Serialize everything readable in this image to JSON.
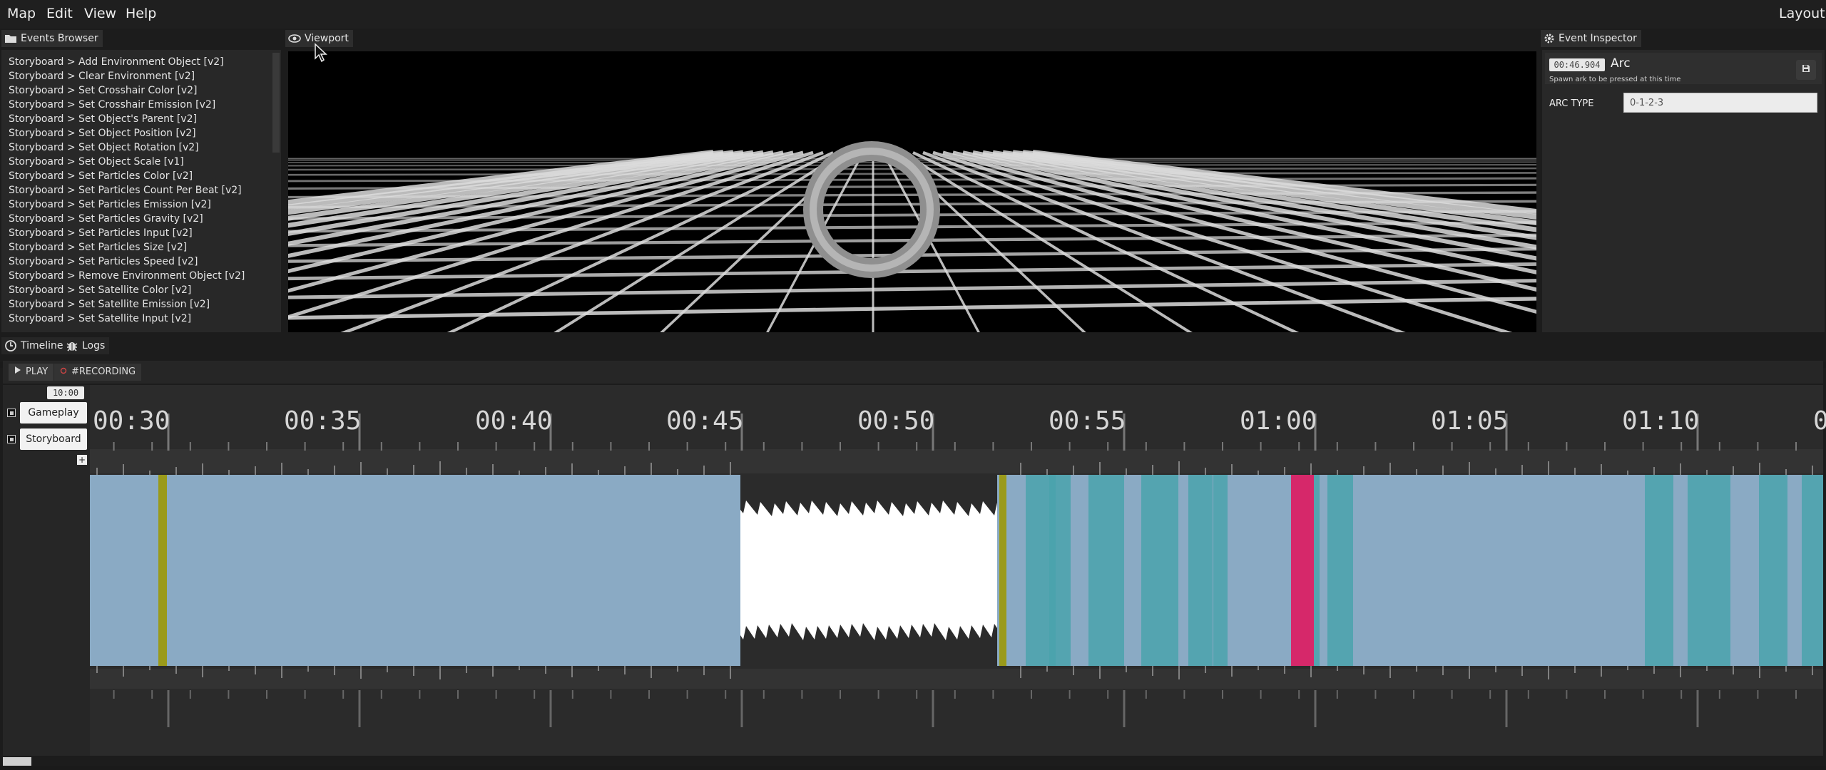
{
  "menu": {
    "items": [
      "Map",
      "Edit",
      "View",
      "Help"
    ],
    "layout": "Layout"
  },
  "panels": {
    "events_browser": "Events Browser",
    "viewport": "Viewport",
    "event_inspector": "Event Inspector",
    "timeline": "Timeline",
    "logs": "Logs"
  },
  "events": [
    "Storyboard > Add Environment Object [v2]",
    "Storyboard > Clear Environment [v2]",
    "Storyboard > Set Crosshair Color [v2]",
    "Storyboard > Set Crosshair Emission [v2]",
    "Storyboard > Set Object's Parent [v2]",
    "Storyboard > Set Object Position [v2]",
    "Storyboard > Set Object Rotation [v2]",
    "Storyboard > Set Object Scale [v1]",
    "Storyboard > Set Particles Color [v2]",
    "Storyboard > Set Particles Count Per Beat [v2]",
    "Storyboard > Set Particles Emission [v2]",
    "Storyboard > Set Particles Gravity [v2]",
    "Storyboard > Set Particles Input [v2]",
    "Storyboard > Set Particles Size [v2]",
    "Storyboard > Set Particles Speed [v2]",
    "Storyboard > Remove Environment Object [v2]",
    "Storyboard > Set Satellite Color [v2]",
    "Storyboard > Set Satellite Emission [v2]",
    "Storyboard > Set Satellite Input [v2]"
  ],
  "inspector": {
    "time": "00:46.904",
    "title": "Arc",
    "description": "Spawn ark to be pressed at this time",
    "field_label": "ARC TYPE",
    "field_value": "0-1-2-3"
  },
  "transport": {
    "play": "PLAY",
    "recording": "#RECORDING"
  },
  "timeline": {
    "current_time": "10:00",
    "tracks": [
      "Gameplay",
      "Storyboard"
    ],
    "add": "+",
    "tick_labels": [
      "00:30",
      "00:35",
      "00:40",
      "00:45",
      "00:50",
      "00:55",
      "01:00",
      "01:05",
      "01:10",
      "0"
    ],
    "colors": {
      "waveform": "#8aaac4",
      "teal": "#4aa3ad",
      "olive": "#9a9a1a",
      "marker": "#d6286a"
    }
  }
}
